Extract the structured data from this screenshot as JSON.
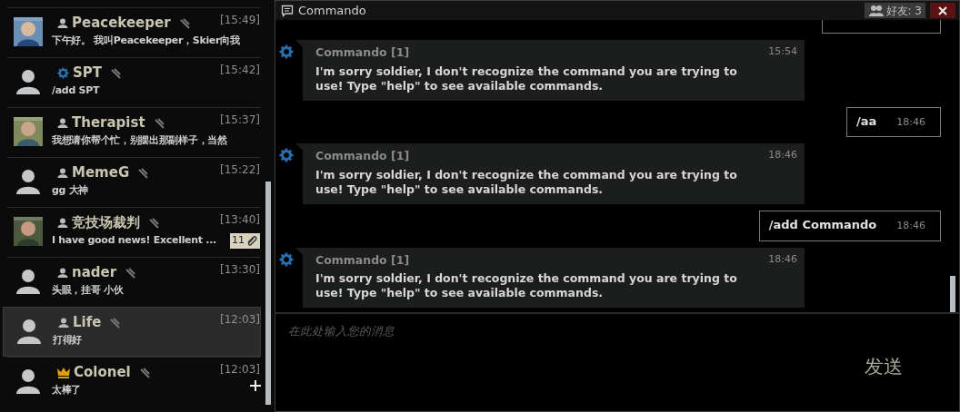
{
  "contacts": [
    {
      "name": "Peacekeeper",
      "role_icon": {
        "kind": "person"
      },
      "time": "[15:49]",
      "preview": "下午好。 我叫Peacekeeper，Skier向我",
      "selected": false
    },
    {
      "name": "SPT",
      "avatar": {
        "kind": "default"
      },
      "role_icon": {
        "kind": "gear"
      },
      "time": "[15:42]",
      "preview": "/add SPT",
      "selected": false
    },
    {
      "name": "Therapist",
      "role_icon": {
        "kind": "person"
      },
      "time": "[15:37]",
      "preview": "我想请你帮个忙，别摆出那副样子，当然",
      "selected": false
    },
    {
      "name": "MemeG",
      "avatar": {
        "kind": "default"
      },
      "role_icon": {
        "kind": "person"
      },
      "time": "[15:22]",
      "preview": "gg 大神",
      "selected": false
    },
    {
      "name": "竞技场裁判",
      "role_icon": {
        "kind": "person"
      },
      "time": "[13:40]",
      "preview": "I have good news! Excellent ...",
      "selected": false,
      "attachments": "11"
    },
    {
      "name": "nader",
      "avatar": {
        "kind": "default"
      },
      "role_icon": {
        "kind": "person"
      },
      "time": "[13:30]",
      "preview": "头眼，挂哥 小伙",
      "selected": false
    },
    {
      "name": "Life",
      "avatar": {
        "kind": "default"
      },
      "role_icon": {
        "kind": "person"
      },
      "time": "[12:03]",
      "preview": "打得好",
      "selected": true
    },
    {
      "name": "Colonel",
      "avatar": {
        "kind": "default"
      },
      "role_icon": {
        "kind": "crown"
      },
      "time": "[12:03]",
      "preview": "太棒了",
      "selected": false
    }
  ],
  "chat": {
    "title": "Commando",
    "friends": "好友: 3",
    "messages": [
      {
        "kind": "outgoing-cut"
      },
      {
        "kind": "incoming",
        "sender": "Commando [1]",
        "time": "15:54",
        "text": "I'm sorry soldier, I don't recognize the command you are trying to use! Type \"help\" to see available commands."
      },
      {
        "kind": "outgoing",
        "text": "/aa",
        "time": "18:46"
      },
      {
        "kind": "incoming",
        "sender": "Commando [1]",
        "time": "18:46",
        "text": "I'm sorry soldier, I don't recognize the command you are trying to use! Type \"help\" to see available commands."
      },
      {
        "kind": "outgoing",
        "text": "/add Commando",
        "time": "18:46"
      },
      {
        "kind": "incoming",
        "sender": "Commando [1]",
        "time": "18:46",
        "text": "I'm sorry soldier, I don't recognize the command you are trying to use! Type \"help\" to see available commands."
      }
    ],
    "placeholder": "在此处输入您的消息",
    "send": "发送"
  }
}
